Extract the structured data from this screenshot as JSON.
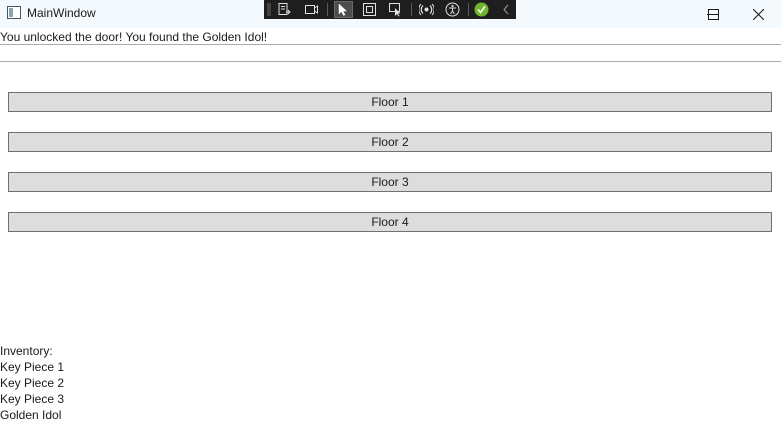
{
  "window": {
    "title": "MainWindow"
  },
  "toolbar": {
    "buttons": [
      {
        "icon": "go-to-live-visual-tree-icon"
      },
      {
        "icon": "display-runtime-tools-icon"
      },
      {
        "icon": "select-element-icon"
      },
      {
        "icon": "display-layout-adorners-icon"
      },
      {
        "icon": "track-focused-element-icon"
      },
      {
        "icon": "hot-reload-icon"
      },
      {
        "icon": "accessibility-checker-icon"
      },
      {
        "icon": "status-ok-icon"
      },
      {
        "icon": "collapse-toolbar-icon"
      }
    ]
  },
  "message": "You unlocked the door! You found the Golden Idol!",
  "floors": [
    {
      "label": "Floor 1"
    },
    {
      "label": "Floor 2"
    },
    {
      "label": "Floor 3"
    },
    {
      "label": "Floor 4"
    }
  ],
  "inventory": {
    "header": "Inventory:",
    "items": [
      "Key Piece 1",
      "Key Piece 2",
      "Key Piece 3",
      "Golden Idol"
    ]
  },
  "colors": {
    "titlebar": "#f3f9fd",
    "button_face": "#dddddd",
    "button_border": "#707070",
    "toolbar": "#1e1e1e",
    "ok_green": "#6fb52c"
  }
}
